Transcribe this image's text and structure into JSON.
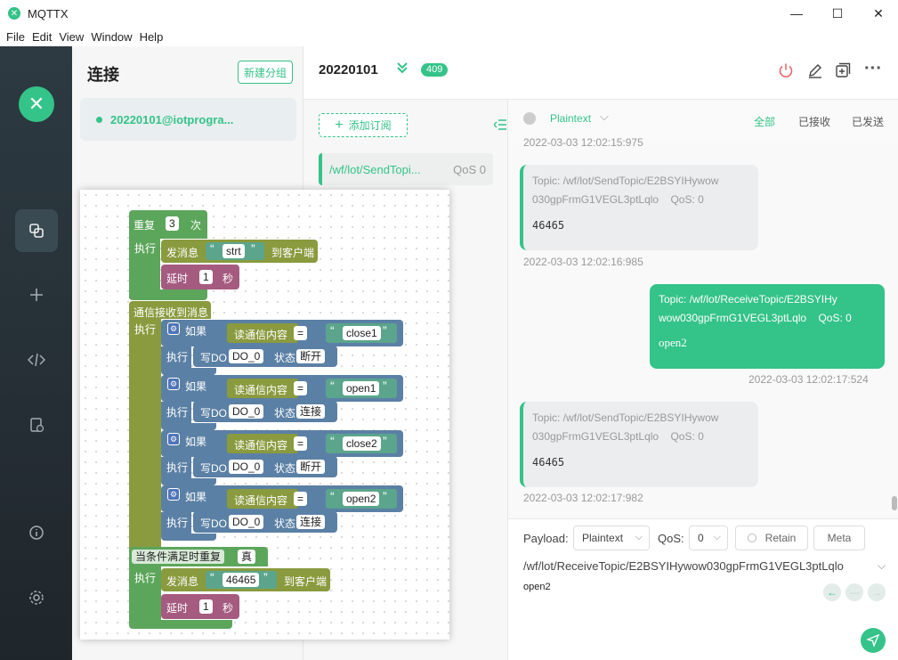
{
  "window": {
    "title": "MQTTX",
    "controls": {
      "minimize": "—",
      "maximize": "☐",
      "close": "✕"
    }
  },
  "menu": [
    "File",
    "Edit",
    "View",
    "Window",
    "Help"
  ],
  "sidebar": {
    "logo_glyph": "✕",
    "icons": [
      "connections-icon",
      "plus-icon",
      "code-icon",
      "log-icon",
      "info-icon",
      "settings-icon"
    ]
  },
  "connections": {
    "title": "连接",
    "new_group": "新建分组",
    "items": [
      {
        "name": "20220101@iotprogra..."
      }
    ]
  },
  "header": {
    "connection_name": "20220101",
    "message_count": "409"
  },
  "subscriptions": {
    "add_label": "添加订阅",
    "items": [
      {
        "topic": "/wf/lot/SendTopi...",
        "qos": "QoS 0"
      }
    ]
  },
  "messages": {
    "format": "Plaintext",
    "filters": [
      "全部",
      "已接收",
      "已发送"
    ],
    "top_timestamp": "2022-03-03 12:02:15:975",
    "list": [
      {
        "direction": "received",
        "topic_line1": "Topic: /wf/lot/SendTopic/E2BSYIHywow",
        "topic_line2": "030gpFrmG1VEGL3ptLqlo",
        "qos": "QoS: 0",
        "payload": "46465",
        "time": "2022-03-03 12:02:16:985"
      },
      {
        "direction": "sent",
        "topic_line1": "Topic: /wf/lot/ReceiveTopic/E2BSYIHy",
        "topic_line2": "wow030gpFrmG1VEGL3ptLqlo",
        "qos": "QoS: 0",
        "payload": "open2",
        "time": "2022-03-03 12:02:17:524"
      },
      {
        "direction": "received",
        "topic_line1": "Topic: /wf/lot/SendTopic/E2BSYIHywow",
        "topic_line2": "030gpFrmG1VEGL3ptLqlo",
        "qos": "QoS: 0",
        "payload": "46465",
        "time": "2022-03-03 12:02:17:982"
      }
    ]
  },
  "publish": {
    "payload_label": "Payload:",
    "payload_format": "Plaintext",
    "qos_label": "QoS:",
    "qos_value": "0",
    "retain_label": "Retain",
    "meta_label": "Meta",
    "topic": "/wf/lot/ReceiveTopic/E2BSYIHywow030gpFrmG1VEGL3ptLqlo",
    "payload": "open2"
  },
  "blockly": {
    "repeat": "重复",
    "repeat_times": "3",
    "times_suffix": "次",
    "exec": "执行",
    "send_msg": "发消息",
    "to_client": "到客户端",
    "msg1": "strt",
    "msg2": "46465",
    "delay": "延时",
    "delay_val": "1",
    "seconds": "秒",
    "on_receive": "通信接收到消息",
    "if": "如果",
    "read_content": "读通信内容",
    "eq": "=",
    "conditions": [
      "close1",
      "open1",
      "close2",
      "open2"
    ],
    "write_do": "写DO",
    "do_port": "DO_0",
    "state": "状态",
    "states": [
      "断开",
      "连接",
      "断开",
      "连接"
    ],
    "repeat_while": "当条件满足时重复",
    "true_val": "真"
  }
}
